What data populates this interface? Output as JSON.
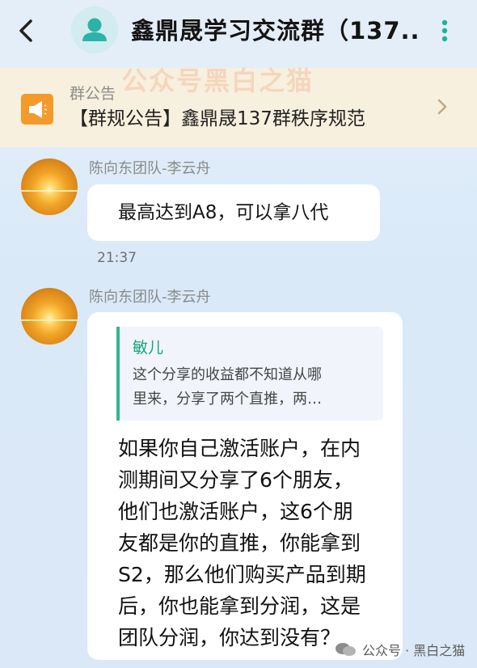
{
  "header": {
    "title": "鑫鼎晟学习交流群（137...",
    "back_icon": "chevron-left-icon",
    "more_icon": "more-vertical-icon",
    "avatar_icon": "person-icon"
  },
  "announcement": {
    "heading": "群公告",
    "text": "【群规公告】鑫鼎晟137群秩序规范",
    "icon": "megaphone-icon"
  },
  "messages": [
    {
      "sender": "陈向东团队-李云舟",
      "text": "最高达到A8，可以拿八代",
      "time": "21:37"
    },
    {
      "sender": "陈向东团队-李云舟",
      "quote": {
        "author": "敏儿",
        "lines": [
          "这个分享的收益都不知道从哪",
          "里来，分享了两个直推，两…"
        ]
      },
      "lines": [
        "如果你自己激活账户，在内",
        "测期间又分享了6个朋友，",
        "他们也激活账户，这6个朋",
        "友都是你的直推，你能拿到",
        "S2，那么他们购买产品到期",
        "后，你也能拿到分润，这是",
        "团队分润，你达到没有？"
      ]
    }
  ],
  "watermarks": {
    "text": "公众号黑白之猫",
    "footer": "公众号 · 黑白之猫"
  },
  "colors": {
    "accent_orange": "#f39a2a",
    "quote_green": "#1ca37d",
    "announcement_bg": "#f8f0de",
    "chat_bg": "#dbe8f7"
  }
}
